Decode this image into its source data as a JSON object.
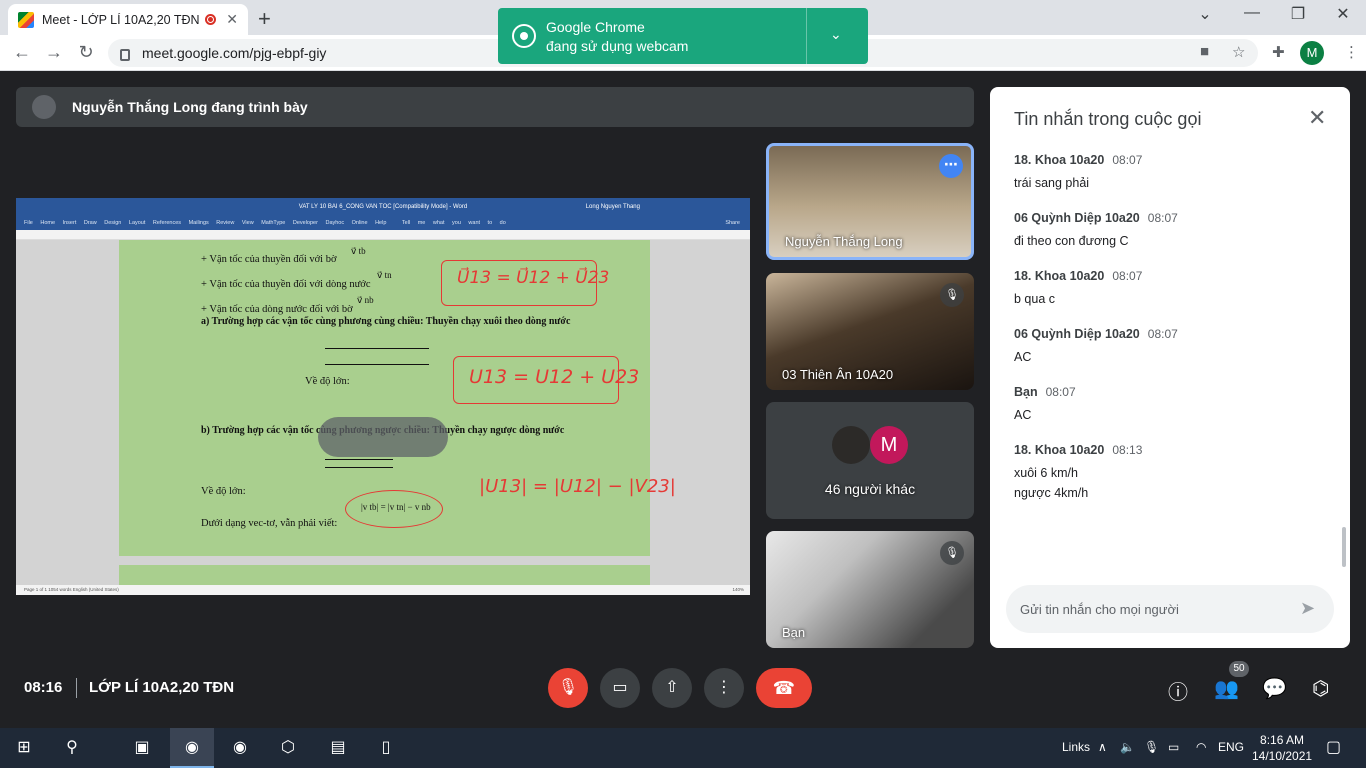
{
  "browser": {
    "tab_title": "Meet - LỚP LÍ 10A2,20 TĐN",
    "tab_close": "✕",
    "new_tab": "+",
    "url": "meet.google.com/pjg-ebpf-giy",
    "profile_initial": "M",
    "window_minimize": "—",
    "window_maximize": "❐",
    "window_close": "✕",
    "tab_menu": "⌄"
  },
  "notification": {
    "line1": "Google Chrome",
    "line2": "đang sử dụng webcam"
  },
  "presenter": {
    "label": "Nguyễn Thắng Long đang trình bày"
  },
  "shared_doc": {
    "window_title": "VAT LY 10 BAI 6_CONG VAN TOC [Compatibility Mode] - Word",
    "user": "Long Nguyen Thang",
    "menu": "File Home Insert Draw Design Layout References Mailings Review View MathType Developer Dayhoc Online Help",
    "tell_me": "Tell me what you want to do",
    "share": "Share",
    "status": "Page 1 of 1   1054 words   English (United States)",
    "zoom": "140%",
    "lines": [
      "+ Vận tốc của thuyền đối với bờ",
      "+ Vận tốc của thuyền đối với dòng nước",
      "+ Vận tốc của dòng nước đối với bờ",
      "a) Trường hợp các vận tốc cùng phương cùng chiều: Thuyền chạy xuôi theo dòng nước",
      "Về độ lớn:",
      "b) Trường hợp các vận tốc cùng phương ngược chiều: Thuyền chạy ngược dòng nước",
      "Về độ lớn:",
      "Dưới dạng vec-tơ, vẫn phải viết:"
    ],
    "vec_labels": [
      "v⃗ tb",
      "v⃗ tn",
      "v⃗ nb"
    ],
    "eq_magnitude": "|v tb| = |v tn| − v nb",
    "ink": {
      "eq1": "U⃗13 = U⃗12 + U⃗23",
      "eq2": "U13 = U12 + U23",
      "eq3": "|U13| = |U12| − |V23|"
    }
  },
  "participants": [
    {
      "name": "Nguyễn Thắng Long",
      "more": "⋯"
    },
    {
      "name": "03 Thiên Ân 10A20",
      "muted": true
    },
    {
      "name": "46 người khác",
      "avatar_letter": "M"
    },
    {
      "name": "Bạn",
      "muted": true
    }
  ],
  "chat": {
    "title": "Tin nhắn trong cuộc gọi",
    "close": "✕",
    "messages": [
      {
        "sender": "18. Khoa 10a20",
        "time": "08:07",
        "text": [
          "trái sang phải"
        ]
      },
      {
        "sender": "06 Quỳnh Diệp 10a20",
        "time": "08:07",
        "text": [
          "đi theo con đương C"
        ]
      },
      {
        "sender": "18. Khoa 10a20",
        "time": "08:07",
        "text": [
          "b qua c"
        ]
      },
      {
        "sender": "06 Quỳnh Diệp 10a20",
        "time": "08:07",
        "text": [
          "AC"
        ]
      },
      {
        "sender": "Bạn",
        "time": "08:07",
        "text": [
          "AC"
        ]
      },
      {
        "sender": "18. Khoa 10a20",
        "time": "08:13",
        "text": [
          "xuôi 6 km/h",
          "ngược 4km/h"
        ]
      }
    ],
    "input_placeholder": "Gửi tin nhắn cho mọi người",
    "send": "➤"
  },
  "bottom_bar": {
    "time": "08:16",
    "meeting_name": "LỚP LÍ 10A2,20 TĐN",
    "mic_icon": "🎙",
    "camera_icon": "▭",
    "present_icon": "⇧",
    "more_icon": "⋮",
    "hangup_icon": "☎",
    "info_icon": "ⓘ",
    "people_icon": "👥",
    "people_count": "50",
    "chat_icon": "💬",
    "activities_icon": "⌬"
  },
  "taskbar": {
    "links": "Links",
    "lang": "ENG",
    "time": "8:16 AM",
    "date": "14/10/2021"
  },
  "colors": {
    "meet_bg": "#202124",
    "notify_green": "#1aa67d",
    "hangup_red": "#ea4335",
    "page_green": "#a9cf8e",
    "ink_red": "#e53935",
    "active_border": "#8ab4f8"
  }
}
